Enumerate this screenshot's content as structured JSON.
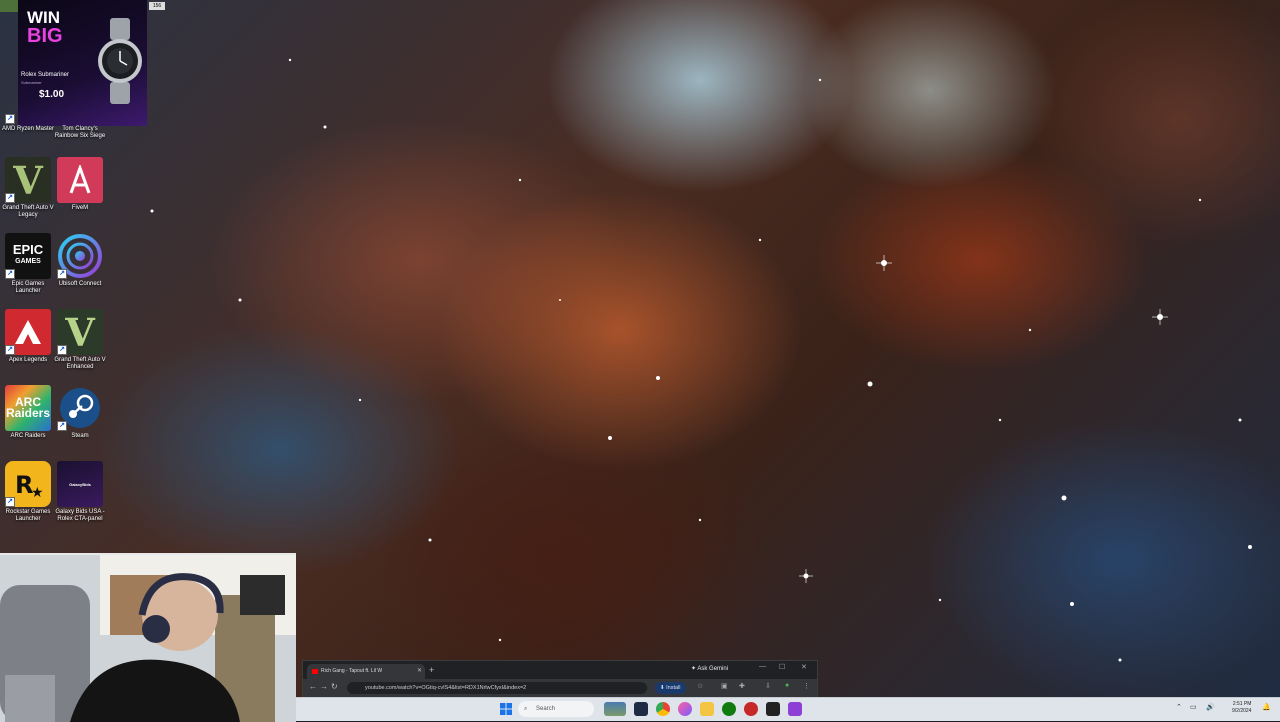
{
  "ad": {
    "headline_1": "WIN",
    "headline_2": "BIG",
    "prize": "Rolex Submariner",
    "prize_sub": "Submariner",
    "price": "$1.00"
  },
  "top_counter": "156",
  "desktop_icons": [
    {
      "label": "AMD Ryzen Master",
      "name": "amd-ryzen-master"
    },
    {
      "label": "Tom Clancy's Rainbow Six Siege",
      "name": "rainbow-six-siege"
    },
    {
      "label": "Grand Theft Auto V Legacy",
      "name": "gta-v-legacy"
    },
    {
      "label": "FiveM",
      "name": "fivem"
    },
    {
      "label": "Epic Games Launcher",
      "name": "epic-games-launcher"
    },
    {
      "label": "Ubisoft Connect",
      "name": "ubisoft-connect"
    },
    {
      "label": "Apex Legends",
      "name": "apex-legends"
    },
    {
      "label": "Grand Theft Auto V Enhanced",
      "name": "gta-v-enhanced"
    },
    {
      "label": "ARC Raiders",
      "name": "arc-raiders"
    },
    {
      "label": "Steam",
      "name": "steam"
    },
    {
      "label": "Rockstar Games Launcher",
      "name": "rockstar-games-launcher"
    },
    {
      "label": "Galaxy Bids USA - Rolex CTA-panel",
      "name": "galaxy-bids"
    }
  ],
  "icon_text": {
    "epic_1": "EPIC",
    "epic_2": "GAMES",
    "arc_1": "ARC",
    "arc_2": "Raiders",
    "galaxy": "GalaxyBids"
  },
  "browser": {
    "tab_title": "Rich Gang - Tapout ft. Lil W",
    "ask_gemini": "Ask Gemini",
    "url": "youtube.com/watch?v=OGtiq-cvIS4&list=RDX1NrlwCfyxI&index=2",
    "install_label": "Install"
  },
  "taskbar": {
    "search_placeholder": "Search",
    "time": "2:51 PM",
    "date": "9/2/2024"
  },
  "colors": {
    "accent": "#1a73e8",
    "ad_pink": "#e843e0",
    "taskbar_bg": "#dfe3ea"
  }
}
